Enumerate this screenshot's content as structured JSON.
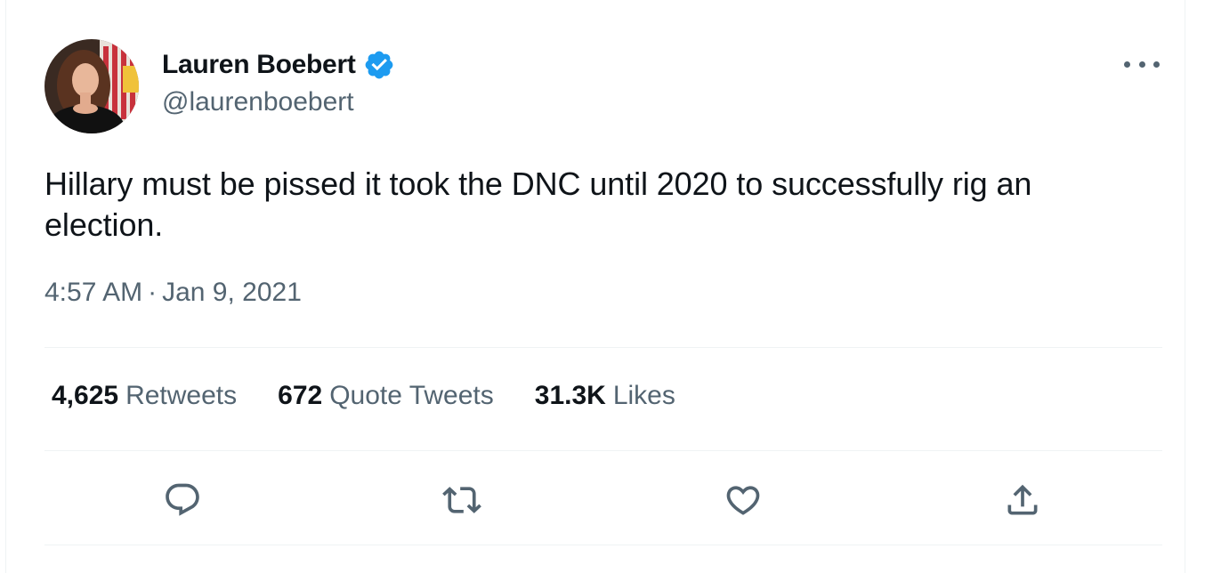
{
  "tweet": {
    "author": {
      "display_name": "Lauren Boebert",
      "handle": "@laurenboebert",
      "verified": true
    },
    "text": "Hillary must be pissed it took the DNC until 2020 to successfully rig an election.",
    "time": "4:57 AM",
    "separator": "·",
    "date": "Jan 9, 2021",
    "stats": {
      "retweets": {
        "count": "4,625",
        "label": "Retweets"
      },
      "quotes": {
        "count": "672",
        "label": "Quote Tweets"
      },
      "likes": {
        "count": "31.3K",
        "label": "Likes"
      }
    },
    "actions": [
      "reply-icon",
      "retweet-icon",
      "like-icon",
      "share-icon"
    ]
  },
  "colors": {
    "primary_text": "#0f1419",
    "secondary_text": "#536471",
    "verified_blue": "#1d9bf0",
    "divider": "#eff3f4"
  }
}
